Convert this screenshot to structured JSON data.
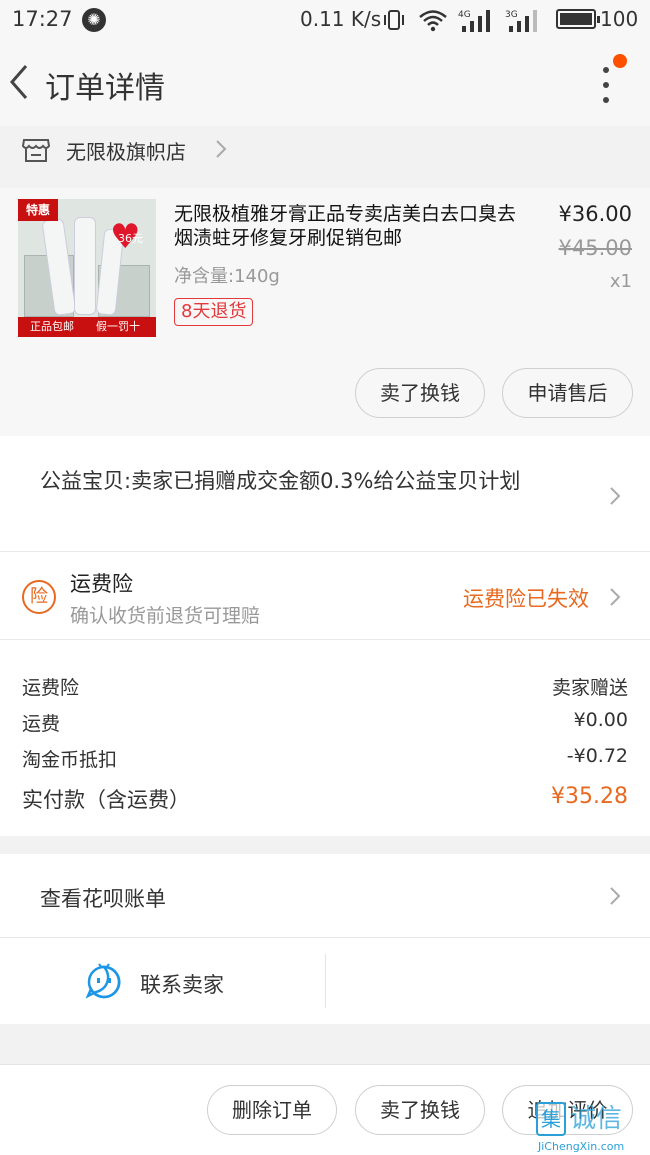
{
  "status_bar": {
    "time": "17:27",
    "network_speed": "0.11 K/s",
    "signal_1_label": "4G",
    "signal_2_label": "3G",
    "battery": "100"
  },
  "nav": {
    "title": "订单详情",
    "back_icon": "chevron-left-icon",
    "more_icon": "more-vertical-icon",
    "notification_color": "#ff5000"
  },
  "shop": {
    "name": "无限极旗帜店",
    "icon": "store-icon"
  },
  "item": {
    "image_badge": "特惠",
    "image_heart_text": "36元",
    "image_strip_left": "正品包邮",
    "image_strip_right": "假一罚十",
    "title": "无限极植雅牙膏正品专卖店美白去口臭去烟渍蛀牙修复牙刷促销包邮",
    "spec": "净含量:140g",
    "refund_tag": "8天退货",
    "price": "¥36.00",
    "original_price": "¥45.00",
    "quantity": "x1"
  },
  "item_actions": {
    "sell_label": "卖了换钱",
    "after_sale_label": "申请售后"
  },
  "charity": {
    "text": "公益宝贝:卖家已捐赠成交金额0.3%给公益宝贝计划"
  },
  "insurance": {
    "icon_label": "险",
    "title": "运费险",
    "subtitle": "确认收货前退货可理赔",
    "status": "运费险已失效",
    "accent_color": "#e76a20"
  },
  "fees": {
    "rows": [
      {
        "label": "运费险",
        "value": "卖家赠送"
      },
      {
        "label": "运费",
        "value": "¥0.00"
      },
      {
        "label": "淘金币抵扣",
        "value": "-¥0.72"
      }
    ],
    "total_label": "实付款（含运费）",
    "total_value": "¥35.28"
  },
  "huabei": {
    "label": "查看花呗账单"
  },
  "contact": {
    "label": "联系卖家",
    "icon": "chat-face-icon"
  },
  "bottom_actions": {
    "delete_label": "删除订单",
    "sell_label": "卖了换钱",
    "review_label": "追加评价"
  },
  "watermark": {
    "logo": "集",
    "text": "诚信",
    "url": "JiChengXin.com"
  }
}
